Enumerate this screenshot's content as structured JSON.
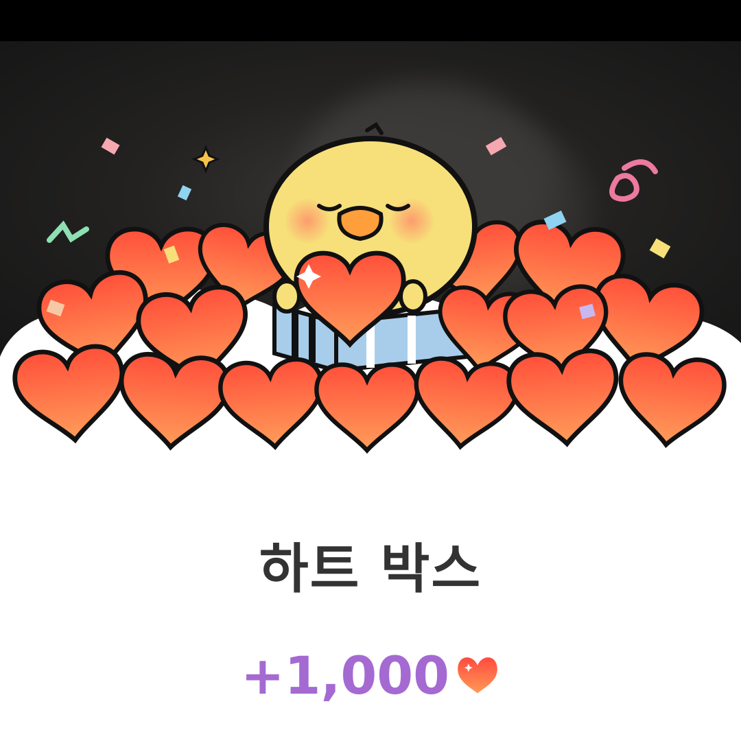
{
  "reward": {
    "title": "하트 박스",
    "amount": "+1,000",
    "icon": "heart-icon"
  },
  "colors": {
    "title": "#333333",
    "amount": "#a46ad2",
    "heart_top": "#ff5a3c",
    "heart_bottom": "#ff9a57",
    "outline": "#111111",
    "character": "#f7e07a"
  }
}
